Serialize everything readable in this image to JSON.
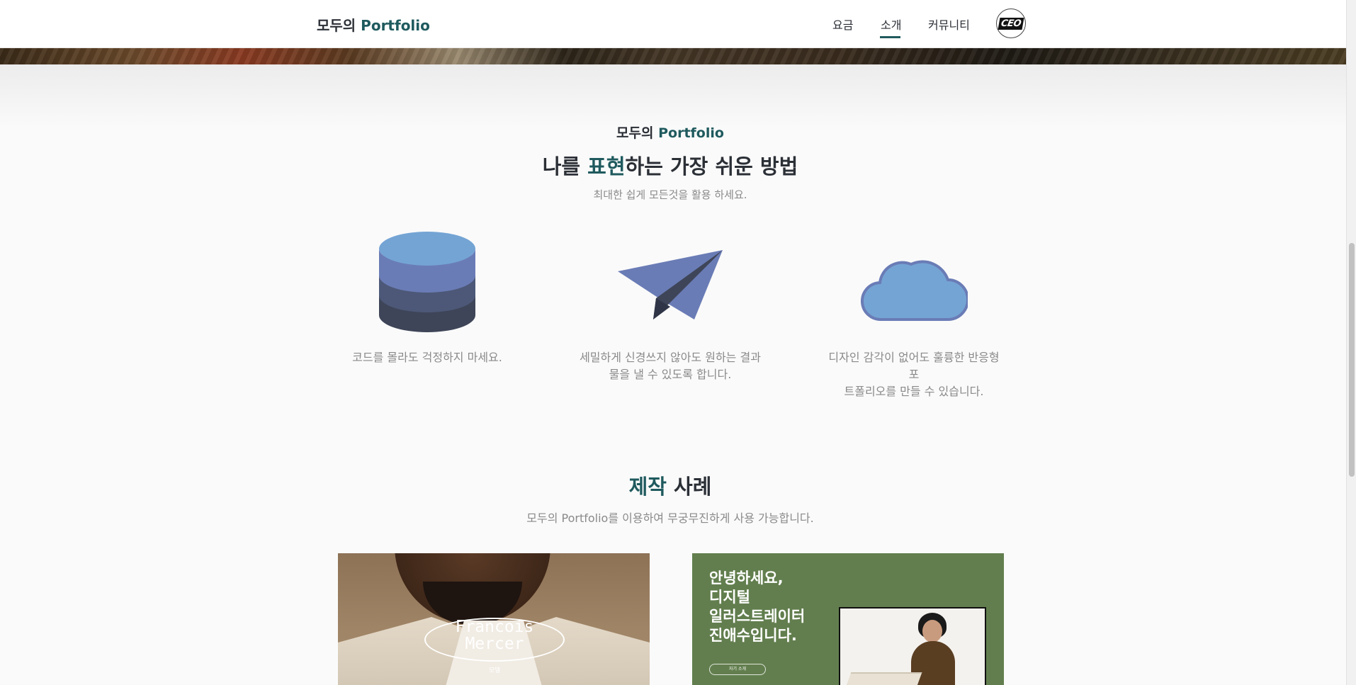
{
  "header": {
    "logo_prefix": "모두의 ",
    "logo_accent": "Portfolio",
    "nav": {
      "pricing": "요금",
      "about": "소개",
      "community": "커뮤니티"
    },
    "avatar_text": "CEO",
    "active_tab": "소개"
  },
  "intro": {
    "small_title_prefix": "모두의 ",
    "small_title_accent": "Portfolio",
    "headline_before": "나를 ",
    "headline_accent": "표현",
    "headline_after": "하는 가장 쉬운 방법",
    "subtitle": "최대한 쉽게 모든것을 활용 하세요."
  },
  "features": [
    {
      "icon": "database-icon",
      "caption": "코드를 몰라도 걱정하지 마세요."
    },
    {
      "icon": "paper-plane-icon",
      "caption_line1": "세밀하게 신경쓰지 않아도 원하는 결과",
      "caption_line2": "물을 낼 수 있도록 합니다."
    },
    {
      "icon": "cloud-icon",
      "caption_line1": "디자인 감각이 없어도 훌륭한 반응형 포",
      "caption_line2": "트폴리오를 만들 수 있습니다."
    }
  ],
  "cases": {
    "title_accent": "제작",
    "title_rest": " 사례",
    "subtitle": "모두의 Portfolio를 이용하여 무궁무진하게 사용 가능합니다.",
    "card1": {
      "name_line1": "Francois",
      "name_line2": "Mercer",
      "role": "모델"
    },
    "card2": {
      "greet_line1": "안녕하세요,",
      "greet_line2": "디지털",
      "greet_line3": "일러스트레이터",
      "greet_line4": "진애수입니다.",
      "pill": "자기 소개"
    }
  },
  "colors": {
    "accent": "#1f5a5e",
    "text": "#2b2f36",
    "muted": "#8a8a8a",
    "icon_light_blue": "#74a4d4",
    "icon_indigo": "#6a7cb6",
    "icon_dark": "#3e4558",
    "card_green": "#627e4e"
  }
}
